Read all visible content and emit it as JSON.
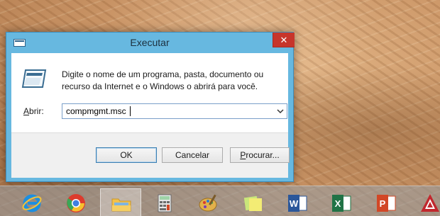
{
  "dialog": {
    "title": "Executar",
    "close_glyph": "✕",
    "description_line1": "Digite o nome de um programa, pasta, documento ou",
    "description_line2": "recurso da Internet e o Windows o abrirá para você.",
    "open_label_underlined": "A",
    "open_label_rest": "brir:",
    "open_value": "compmgmt.msc",
    "buttons": {
      "ok": "OK",
      "cancel": "Cancelar",
      "browse_underlined": "P",
      "browse_rest": "rocurar..."
    },
    "icon": "run-icon"
  },
  "taskbar": {
    "items": [
      {
        "name": "internet-explorer",
        "icon": "internet-explorer-icon",
        "color": "#1d8fe0"
      },
      {
        "name": "chrome",
        "icon": "chrome-icon",
        "color": "#dd3b2d"
      },
      {
        "name": "file-explorer",
        "icon": "folder-icon",
        "color": "#f2c14b",
        "active": true
      },
      {
        "name": "calculator",
        "icon": "calculator-icon",
        "color": "#6b6b6b"
      },
      {
        "name": "paint",
        "icon": "paint-palette-icon",
        "color": "#e2b04a"
      },
      {
        "name": "sticky-notes",
        "icon": "sticky-notes-icon",
        "color": "#e8e36a"
      },
      {
        "name": "word",
        "icon": "word-icon",
        "color": "#2b579a",
        "letter": "W"
      },
      {
        "name": "excel",
        "icon": "excel-icon",
        "color": "#217346",
        "letter": "X"
      },
      {
        "name": "powerpoint",
        "icon": "powerpoint-icon",
        "color": "#d24726",
        "letter": "P"
      },
      {
        "name": "autocad",
        "icon": "autocad-icon",
        "color": "#c1272d",
        "letter": "A"
      }
    ]
  },
  "colors": {
    "dialog_frame": "#67b8e0",
    "close_button": "#c7352b"
  }
}
